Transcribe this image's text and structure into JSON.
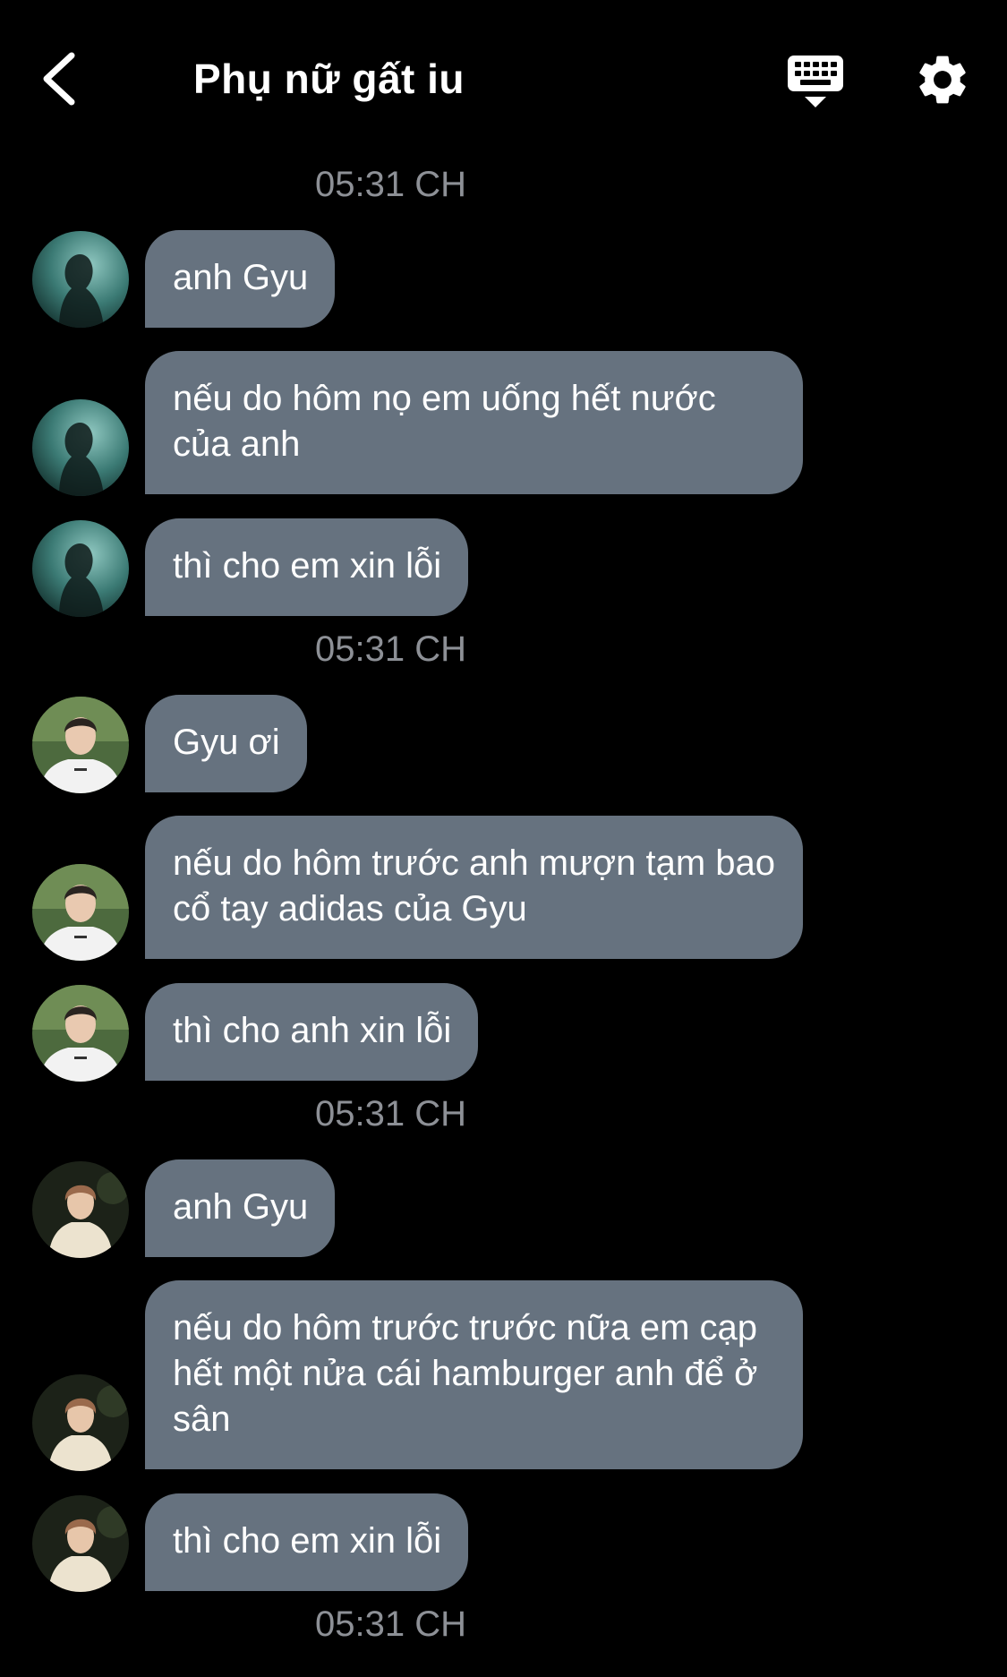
{
  "header": {
    "title": "Phụ nữ gất iu",
    "back_icon": "chevron-left-icon",
    "keyboard_icon": "keyboard-icon",
    "settings_icon": "gear-icon"
  },
  "colors": {
    "background": "#000000",
    "bubble": "#66727f",
    "timestamp": "#8d9096",
    "text": "#ffffff"
  },
  "timestamps": [
    "05:31 CH",
    "05:31 CH",
    "05:31 CH",
    "05:31 CH"
  ],
  "messages": [
    {
      "sender_avatar": "avatar-teal",
      "text": "anh Gyu"
    },
    {
      "sender_avatar": "avatar-teal",
      "text": "nếu do hôm nọ em uống hết nước của anh"
    },
    {
      "sender_avatar": "avatar-teal",
      "text": "thì cho em xin lỗi"
    },
    {
      "sender_avatar": "avatar-white-shirt",
      "text": "Gyu ơi"
    },
    {
      "sender_avatar": "avatar-white-shirt",
      "text": "nếu do hôm trước anh mượn tạm bao cổ tay adidas của Gyu"
    },
    {
      "sender_avatar": "avatar-white-shirt",
      "text": "thì cho anh xin lỗi"
    },
    {
      "sender_avatar": "avatar-jacket",
      "text": "anh Gyu"
    },
    {
      "sender_avatar": "avatar-jacket",
      "text": "nếu do hôm trước trước nữa em cạp hết một nửa cái hamburger anh để ở sân"
    },
    {
      "sender_avatar": "avatar-jacket",
      "text": "thì cho em xin lỗi"
    }
  ]
}
